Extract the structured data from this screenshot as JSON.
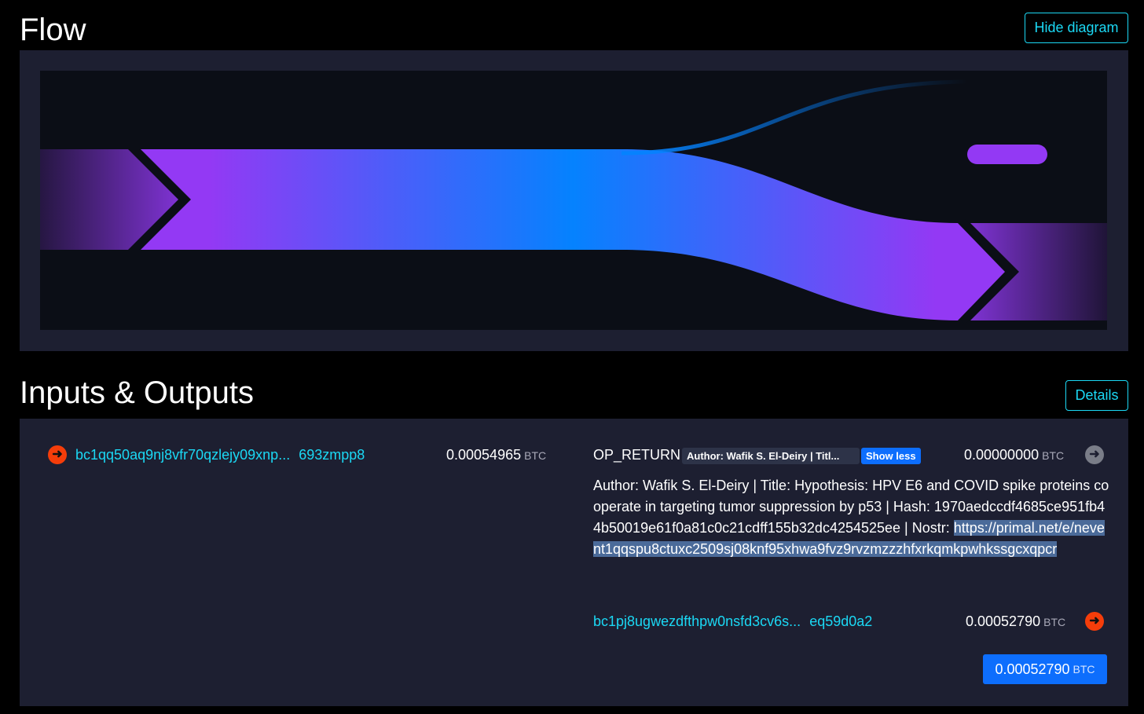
{
  "flow": {
    "title": "Flow",
    "hide_label": "Hide diagram"
  },
  "io": {
    "title": "Inputs & Outputs",
    "details_label": "Details",
    "input": {
      "address": "bc1qq50aq9nj8vfr70qzlejy09xnp...",
      "address_tail": "693zmpp8",
      "amount": "0.00054965",
      "unit": "BTC"
    },
    "op_return": {
      "label": "OP_RETURN",
      "badge": "Author: Wafik S. El-Deiry | Titl...",
      "show_less": "Show less",
      "amount": "0.00000000",
      "unit": "BTC",
      "description": "Author: Wafik S. El-Deiry | Title: Hypothesis: HPV E6 and COVID spike proteins cooperate in targeting tumor suppression by p53 | Hash: 1970aedccdf4685ce951fb44b50019e61f0a81c0c21cdff155b32dc4254525ee | Nostr:",
      "nostr_link": "https://primal.net/e/nevent1qqspu8ctuxc2509sj08knf95xhwa9fvz9rvzmzzzhfxrkqmkpwhkssgcxqpcr"
    },
    "output": {
      "address": "bc1pj8ugwezdfthpw0nsfd3cv6s...",
      "address_tail": "eq59d0a2",
      "amount": "0.00052790",
      "unit": "BTC"
    },
    "total": {
      "amount": "0.00052790",
      "unit": "BTC"
    }
  },
  "icons": {
    "input_arrow": "arrow-right-circle-icon",
    "op_return_arrow": "arrow-right-circle-icon",
    "output_arrow": "arrow-right-circle-icon"
  },
  "colors": {
    "accent": "#1bd8f4",
    "flow_purple": "#9339f4",
    "flow_blue": "#0582fe",
    "total_button": "#0d6efd",
    "arrow_red": "#f53d0a",
    "panel_bg": "#1d1f31"
  }
}
